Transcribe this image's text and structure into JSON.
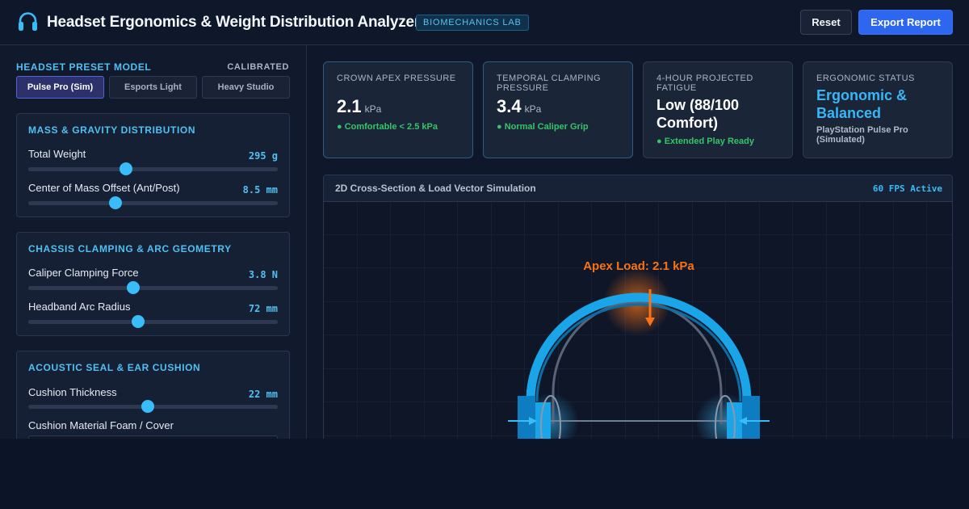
{
  "header": {
    "title": "Headset Ergonomics & Weight Distribution Analyzer",
    "badge": "BIOMECHANICS LAB",
    "reset_label": "Reset",
    "export_label": "Export Report",
    "logo_icon": "headphones-icon"
  },
  "sidebar": {
    "preset_title": "HEADSET PRESET MODEL",
    "preset_status": "CALIBRATED",
    "presets": [
      {
        "label": "Pulse Pro (Sim)",
        "active": true
      },
      {
        "label": "Esports Light",
        "active": false
      },
      {
        "label": "Heavy Studio",
        "active": false
      }
    ],
    "mass_panel": {
      "title": "MASS & GRAVITY DISTRIBUTION",
      "controls": [
        {
          "label": "Total Weight",
          "value": "295 g",
          "level": 0.39
        },
        {
          "label": "Center of Mass Offset (Ant/Post)",
          "value": "8.5 mm",
          "level": 0.35
        }
      ]
    },
    "chassis_panel": {
      "title": "CHASSIS CLAMPING & ARC GEOMETRY",
      "controls": [
        {
          "label": "Caliper Clamping Force",
          "value": "3.8 N",
          "level": 0.42
        },
        {
          "label": "Headband Arc Radius",
          "value": "72 mm",
          "level": 0.44
        }
      ]
    },
    "acoustic_panel": {
      "title": "ACOUSTIC SEAL & EAR CUSHION",
      "controls": [
        {
          "label": "Cushion Thickness",
          "value": "22 mm",
          "level": 0.48
        }
      ],
      "material_label": "Cushion Material Foam / Cover"
    }
  },
  "metrics": {
    "crown": {
      "label": "CROWN APEX PRESSURE",
      "value": "2.1",
      "unit": "kPa",
      "note": "● Comfortable < 2.5 kPa"
    },
    "temporal": {
      "label": "TEMPORAL CLAMPING PRESSURE",
      "value": "3.4",
      "unit": "kPa",
      "note": "● Normal Caliper Grip"
    },
    "fatigue": {
      "label": "4-HOUR PROJECTED FATIGUE",
      "value": "Low (88/100 Comfort)",
      "note": "● Extended Play Ready"
    },
    "status": {
      "label": "ERGONOMIC STATUS",
      "value": "Ergonomic & Balanced",
      "sub": "PlayStation Pulse Pro (Simulated)"
    }
  },
  "simulation": {
    "title": "2D Cross-Section & Load Vector Simulation",
    "fps": "60 FPS Active",
    "apex_label": "Apex Load: 2.1 kPa"
  },
  "colors": {
    "accent": "#38bdf8",
    "primary_button": "#2d67f0",
    "ok": "#35c46a",
    "load": "#f97316"
  }
}
